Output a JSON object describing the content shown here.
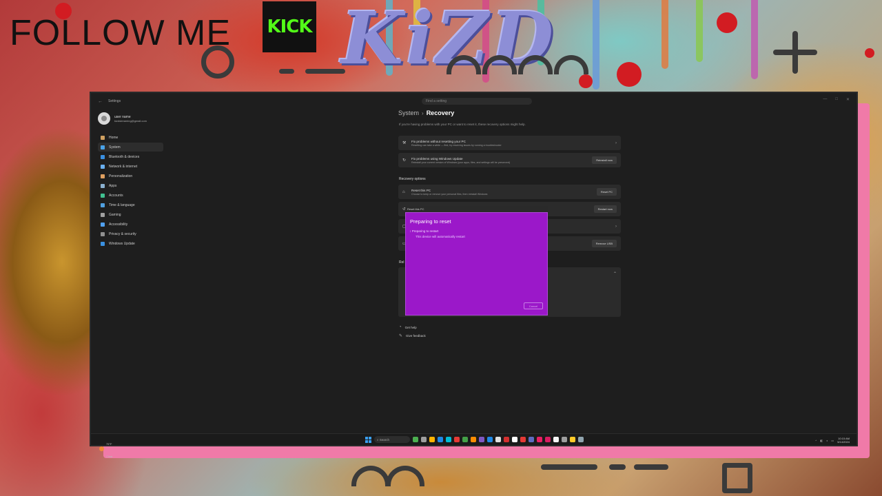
{
  "overlay": {
    "follow_text": "FOLLOW ME",
    "kick_logo": "KICK",
    "brand_logo": "KiZD"
  },
  "window": {
    "title": "Settings",
    "search_placeholder": "Find a setting"
  },
  "profile": {
    "name": "user name",
    "email": "kizdstreaming@gmail.com"
  },
  "sidebar": {
    "items": [
      {
        "label": "Home",
        "icon": "home-icon",
        "color": "#d0a060"
      },
      {
        "label": "System",
        "icon": "monitor-icon",
        "color": "#4aa3e8",
        "active": true
      },
      {
        "label": "Bluetooth & devices",
        "icon": "bluetooth-icon",
        "color": "#3a8fe0"
      },
      {
        "label": "Network & internet",
        "icon": "wifi-icon",
        "color": "#6ab0f0"
      },
      {
        "label": "Personalization",
        "icon": "brush-icon",
        "color": "#e0a060"
      },
      {
        "label": "Apps",
        "icon": "apps-icon",
        "color": "#8ab0d0"
      },
      {
        "label": "Accounts",
        "icon": "person-icon",
        "color": "#40c090"
      },
      {
        "label": "Time & language",
        "icon": "globe-icon",
        "color": "#50a0e0"
      },
      {
        "label": "Gaming",
        "icon": "gamepad-icon",
        "color": "#a0a0a0"
      },
      {
        "label": "Accessibility",
        "icon": "accessibility-icon",
        "color": "#50a0f0"
      },
      {
        "label": "Privacy & security",
        "icon": "shield-icon",
        "color": "#909090"
      },
      {
        "label": "Windows Update",
        "icon": "update-icon",
        "color": "#3a90e0"
      }
    ]
  },
  "main": {
    "breadcrumb_parent": "System",
    "breadcrumb_current": "Recovery",
    "intro": "If you're having problems with your PC or want to reset it, these recovery options might help.",
    "cards": [
      {
        "title": "Fix problems without resetting your PC",
        "sub": "Resetting can take a while — first, try resolving issues by running a troubleshooter",
        "action": "›"
      },
      {
        "title": "Fix problems using Windows Update",
        "sub": "Reinstall your current version of Windows (your apps, files, and settings will be preserved)",
        "action": "Reinstall now"
      }
    ],
    "recovery_heading": "Recovery options",
    "recovery_cards": [
      {
        "title": "Reset this PC",
        "sub": "Choose to keep or remove your personal files, then reinstall Windows",
        "action": "Reset PC"
      },
      {
        "title": "",
        "sub": "",
        "action": "Restart now"
      },
      {
        "title": "",
        "sub": "",
        "action": "›"
      },
      {
        "title": "",
        "sub": "",
        "action": "Remove USB"
      }
    ],
    "related_heading": "Rel",
    "links": [
      {
        "label": "Get help",
        "icon": "help-icon"
      },
      {
        "label": "Give feedback",
        "icon": "feedback-icon"
      }
    ]
  },
  "dialog": {
    "header": "Reset this PC",
    "title": "Preparing to reset",
    "line1": "Preparing to restart",
    "line2": "This device will automatically restart",
    "button": "Cancel"
  },
  "taskbar": {
    "weather_temp": "75°F",
    "weather_desc": "Clear",
    "search_label": "Search",
    "time": "10:15 AM",
    "date": "5/14/2024",
    "apps": [
      "#4caf50",
      "#9e9e9e",
      "#ffb300",
      "#1e88e5",
      "#00bcd4",
      "#e53935",
      "#43a047",
      "#fb8c00",
      "#7e57c2",
      "#1e88e5",
      "#e0e0e0",
      "#d32f2f",
      "#ffffff",
      "#e53935",
      "#5c6bc0",
      "#e91e63",
      "#d81b60",
      "#f5f5f5",
      "#9e9e9e",
      "#ffca28",
      "#90a4ae"
    ]
  }
}
